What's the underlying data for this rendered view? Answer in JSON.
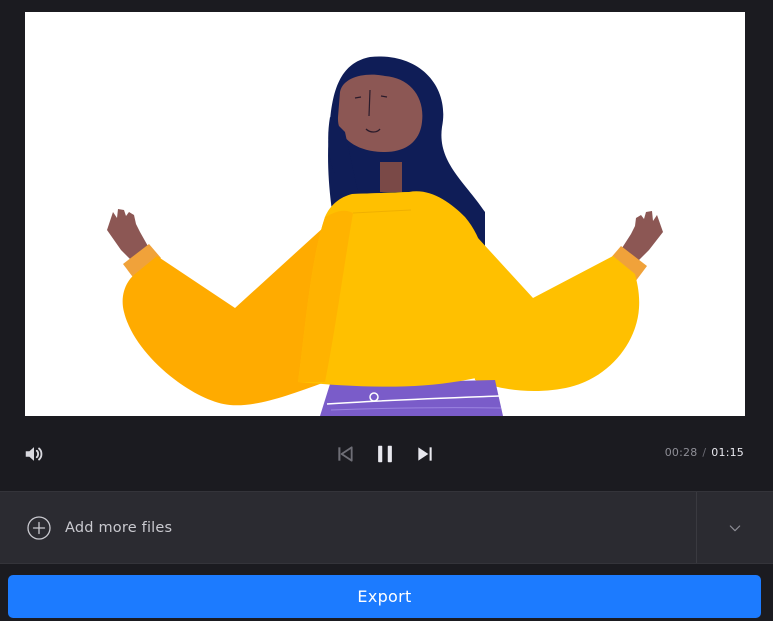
{
  "player": {
    "current_time": "00:28",
    "time_separator": "/",
    "total_time": "01:15",
    "icons": {
      "volume": "speaker-icon",
      "previous": "skip-previous-icon",
      "pause": "pause-icon",
      "next": "skip-next-icon"
    }
  },
  "files": {
    "add_label": "Add more files",
    "add_icon": "plus-circle-icon",
    "toggle_icon": "chevron-down-icon"
  },
  "export": {
    "label": "Export"
  },
  "colors": {
    "background": "#1b1b20",
    "panel": "#2b2b31",
    "accent": "#1c7bff",
    "sweater": "#ffc000",
    "hair": "#0f1d57",
    "skin": "#8c5754",
    "pants": "#7a5cc9"
  }
}
